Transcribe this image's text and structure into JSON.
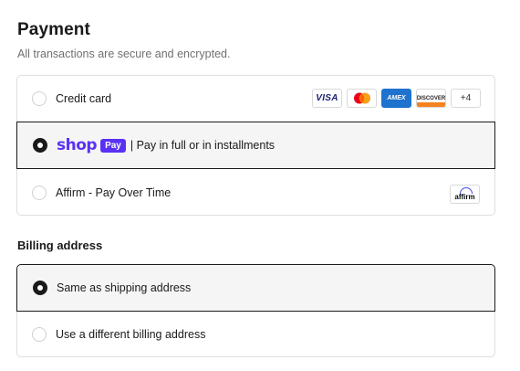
{
  "payment": {
    "title": "Payment",
    "subtitle": "All transactions are secure and encrypted.",
    "options": {
      "credit_card": {
        "label": "Credit card",
        "selected": false,
        "card_icons": [
          {
            "name": "visa-icon",
            "text": "VISA"
          },
          {
            "name": "mastercard-icon",
            "text": ""
          },
          {
            "name": "amex-icon",
            "text": "AMEX"
          },
          {
            "name": "discover-icon",
            "text": "DISCOVER"
          }
        ],
        "more": "+4"
      },
      "shop_pay": {
        "logo_word": "shop",
        "logo_pill": "Pay",
        "label": "| Pay in full or in installments",
        "selected": true,
        "brand_color": "#5a31f4"
      },
      "affirm": {
        "label": "Affirm - Pay Over Time",
        "selected": false,
        "badge": "affirm",
        "brand_color": "#4a4af4"
      }
    }
  },
  "billing": {
    "title": "Billing address",
    "options": {
      "same": {
        "label": "Same as shipping address",
        "selected": true
      },
      "different": {
        "label": "Use a different billing address",
        "selected": false
      }
    }
  },
  "colors": {
    "border": "#dedede",
    "selected_bg": "#f5f5f5",
    "text": "#1a1a1a",
    "muted": "#707070"
  }
}
